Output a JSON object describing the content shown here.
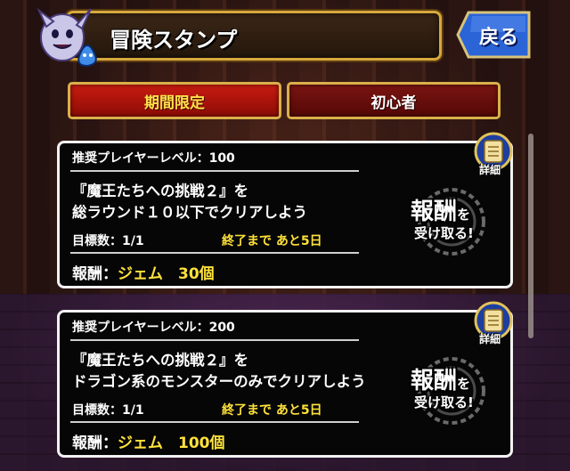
{
  "header": {
    "title": "冒険スタンプ",
    "back_label": "戻る"
  },
  "tabs": [
    {
      "label": "期間限定",
      "active": true
    },
    {
      "label": "初心者",
      "active": false
    }
  ],
  "colors": {
    "accent_gold": "#d6a93c",
    "tab_active": "#c81c10",
    "highlight_yellow": "#ffe23a",
    "back_blue": "#2060d8"
  },
  "missions": [
    {
      "recommended": "推奨プレイヤーレベル：100",
      "line1": "『魔王たちへの挑戦２』を",
      "line2": "総ラウンド１０以下でクリアしよう",
      "goal_label": "目標数：",
      "goal_value": "1/1",
      "deadline": "終了まで あと5日",
      "reward_label": "報酬：",
      "reward_value": "ジェム　30個",
      "claim_main": "報酬",
      "claim_suffix": "を",
      "claim_sub": "受け取る!",
      "detail_label": "詳細"
    },
    {
      "recommended": "推奨プレイヤーレベル：200",
      "line1": "『魔王たちへの挑戦２』を",
      "line2": "ドラゴン系のモンスターのみでクリアしよう",
      "goal_label": "目標数：",
      "goal_value": "1/1",
      "deadline": "終了まで あと5日",
      "reward_label": "報酬：",
      "reward_value": "ジェム　100個",
      "claim_main": "報酬",
      "claim_suffix": "を",
      "claim_sub": "受け取る!",
      "detail_label": "詳細"
    }
  ]
}
